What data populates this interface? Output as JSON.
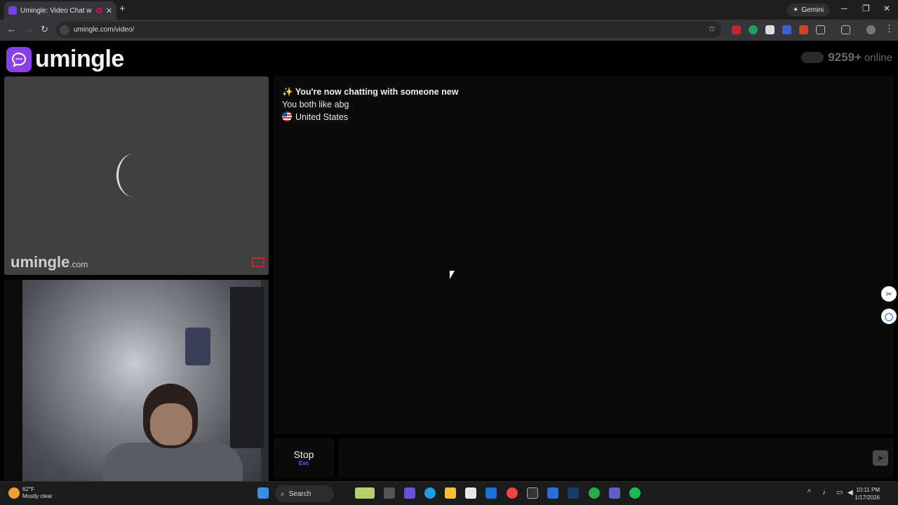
{
  "browser": {
    "tab_title": "Umingle: Video Chat with S",
    "new_tab": "+",
    "gemini_label": "Gemini",
    "url": "umingle.com/video/"
  },
  "page": {
    "logo_text": "umingle",
    "online_count": "9259+",
    "online_label": "online",
    "remote_watermark": "umingle",
    "remote_watermark_suffix": ".com",
    "chat": {
      "status_line": "You're now chatting with someone new",
      "status_emoji": "✨",
      "interest_line": "You both like abg",
      "country": "United States"
    },
    "stop_label": "Stop",
    "stop_shortcut": "Esc",
    "message_placeholder": ""
  },
  "taskbar": {
    "temperature": "62°F",
    "weather": "Mostly clear",
    "search_label": "Search",
    "time": "10:11 PM",
    "date": "1/17/2026"
  },
  "icons": {
    "colors": {
      "accent": "#8b3fe6",
      "report": "#c0282e"
    }
  }
}
